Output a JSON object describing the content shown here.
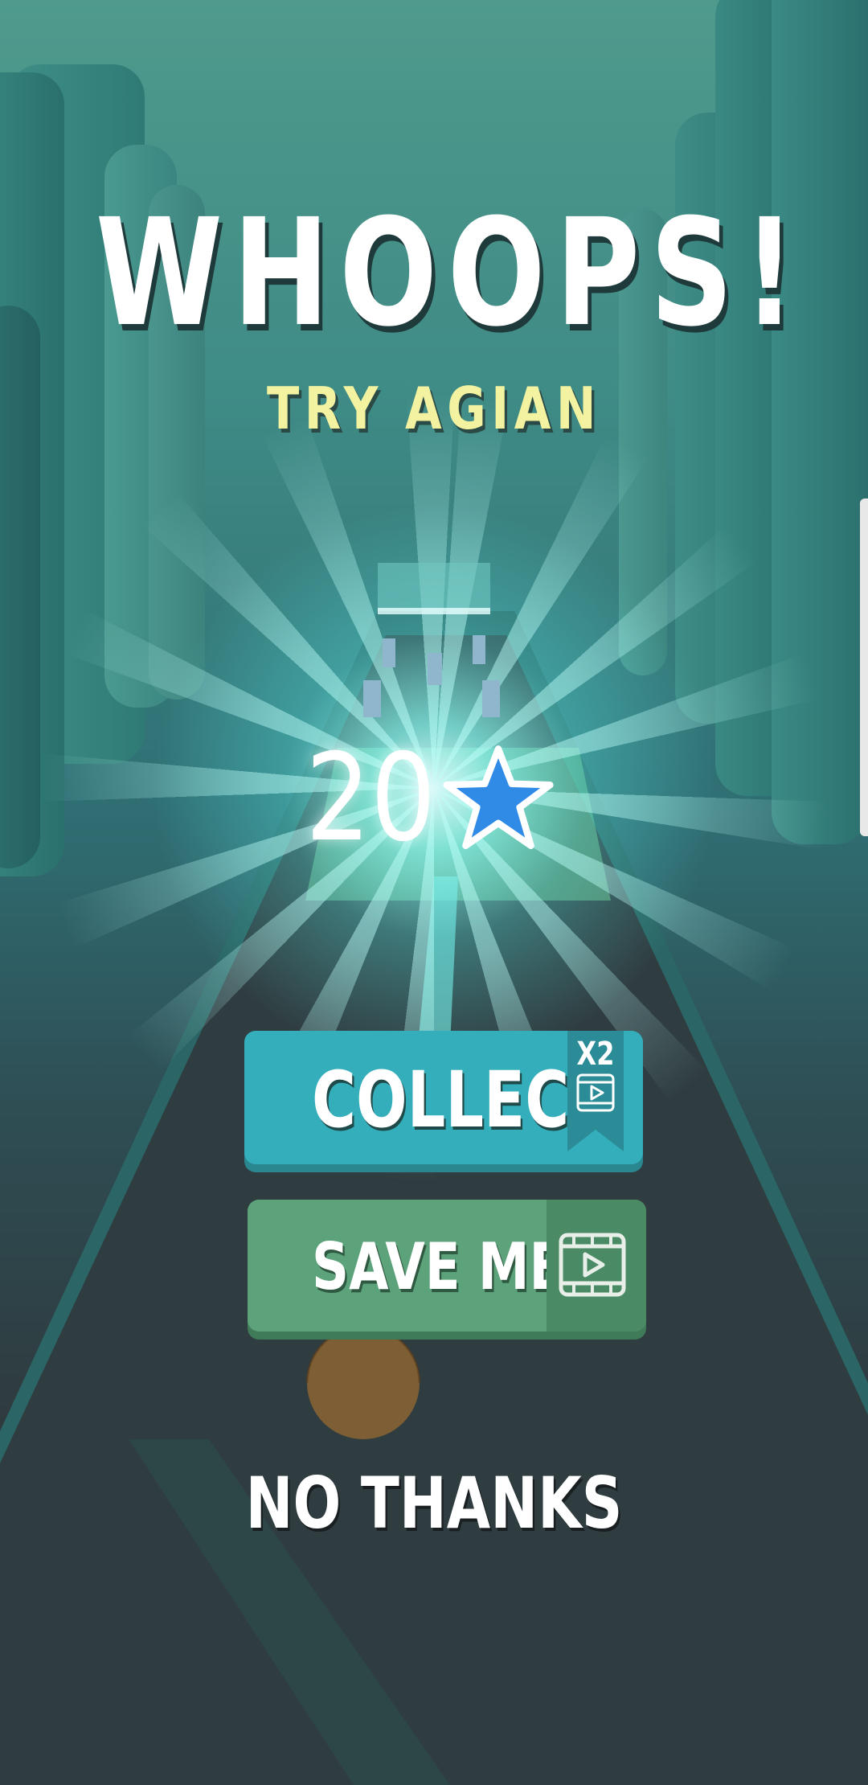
{
  "screen": {
    "title": "WHOOPS!",
    "subtitle": "TRY AGIAN",
    "score": "20",
    "score_icon": "star-icon"
  },
  "buttons": {
    "collect": {
      "label": "COLLECT",
      "multiplier": "X2",
      "icon": "video-ad-icon",
      "color": "#35aebc"
    },
    "save_me": {
      "label": "SAVE ME",
      "icon": "video-ad-icon",
      "color": "#5ca27a"
    },
    "no_thanks": {
      "label": "NO THANKS"
    }
  },
  "colors": {
    "title": "#ffffff",
    "subtitle": "#f2f2a0",
    "star": "#2f8be6"
  }
}
